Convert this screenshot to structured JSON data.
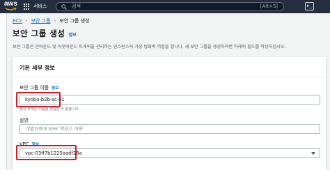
{
  "nav": {
    "logo_text": "aws",
    "services_label": "서비스",
    "search_placeholder": "검색",
    "search_shortcut": "[Alt+S]",
    "cloudshell_glyph": "▸_"
  },
  "breadcrumb": {
    "items": [
      "EC2",
      "보안 그룹",
      "보안 그룹 생성"
    ],
    "separator": "›"
  },
  "page": {
    "title": "보안 그룹 생성",
    "info_link": "정보",
    "description": "보안 그룹은 인바운드 및 아웃바운드 트래픽을 관리하는 인스턴스의 가상 방화벽 역할을 합니다. 새 보안 그룹을 생성하려면 아래의 필드를 작성하십시오."
  },
  "section": {
    "title": "기본 세부 정보",
    "fields": {
      "name": {
        "label": "보안 그룹 이름",
        "info": "정보",
        "value": "kyobo-b2b-sc-01",
        "hint": "생성 후에는 이름을 편집할 수 없습니다."
      },
      "description": {
        "label": "설명",
        "placeholder": "개발자에게 SSH 액세스 허용"
      },
      "vpc": {
        "label": "VPC",
        "info": "정보",
        "value": "vpc-03ff7b1225aadf28a"
      }
    }
  },
  "colors": {
    "nav_bg": "#232f3e",
    "link": "#0073bb",
    "highlight": "#e0141e",
    "page_bg": "#f2f3f3"
  }
}
